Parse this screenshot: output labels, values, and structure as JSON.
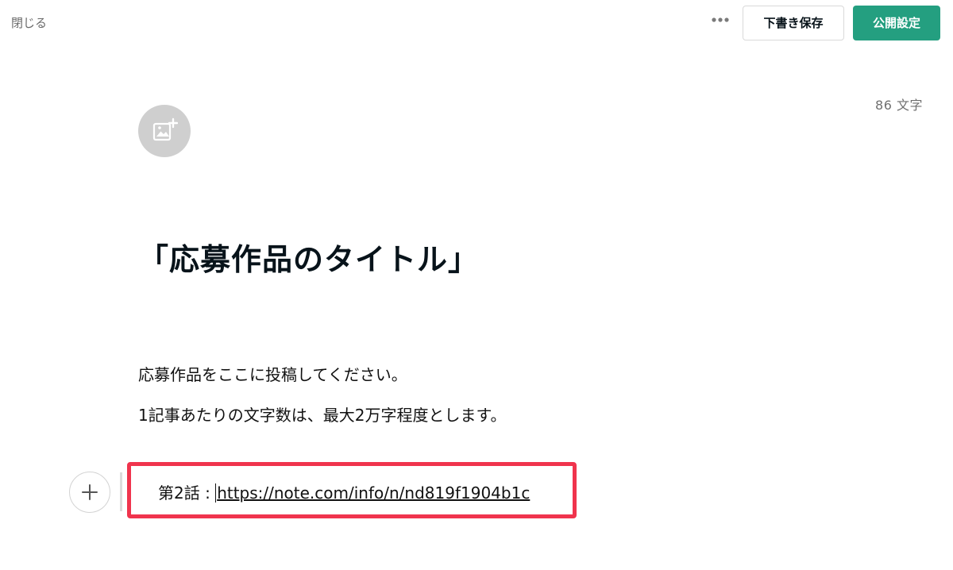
{
  "header": {
    "close_label": "閉じる",
    "more_icon": "more-horizontal-icon",
    "draft_label": "下書き保存",
    "publish_label": "公開設定"
  },
  "editor": {
    "char_count": "86 文字",
    "image_add_icon": "add-image-icon",
    "title": "「応募作品のタイトル」",
    "body_lines": [
      "応募作品をここに投稿してください。",
      "1記事あたりの文字数は、最大2万字程度とします。"
    ],
    "active_block": {
      "prefix": "第2話 : ",
      "link_text": "https://note.com/info/n/nd819f1904b1c"
    },
    "add_block_icon": "plus-icon"
  },
  "colors": {
    "accent": "#249f80",
    "highlight": "#f0344d"
  }
}
